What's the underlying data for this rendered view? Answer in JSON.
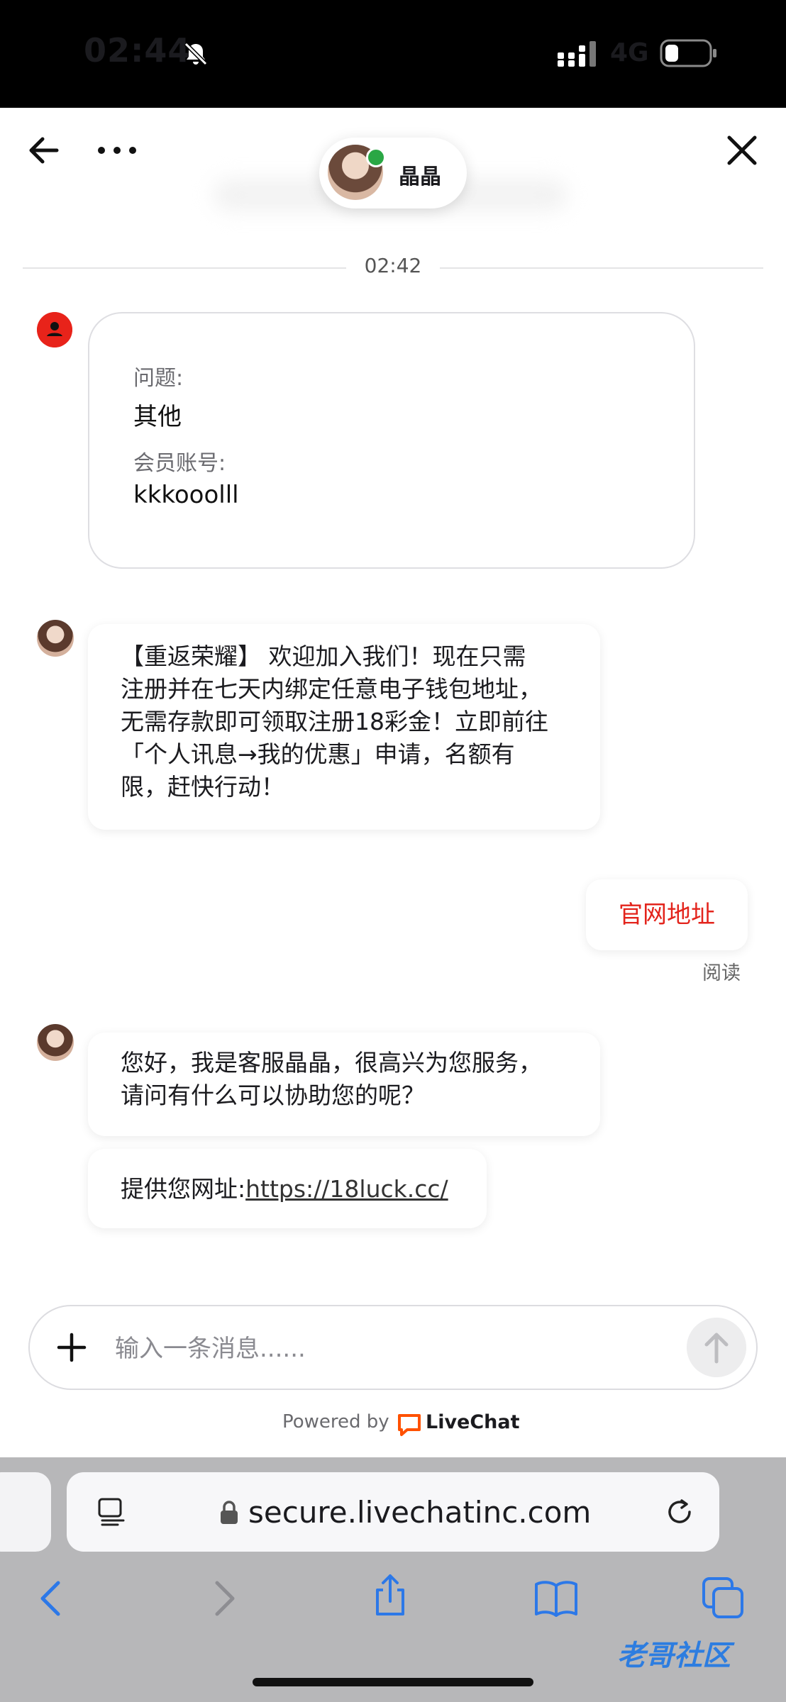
{
  "status_bar": {
    "time": "02:44",
    "network": "4G"
  },
  "header": {
    "agent_name": "晶晶"
  },
  "divider": {
    "time": "02:42"
  },
  "form": {
    "question_label": "问题:",
    "question_value": "其他",
    "account_label": "会员账号:",
    "account_value": "kkkooolll"
  },
  "messages": {
    "promo": "【重返荣耀】 欢迎加入我们！现在只需\n注册并在七天内绑定任意电子钱包地址，\n无需存款即可领取注册18彩金！立即前往\n「个人讯息→我的优惠」申请，名额有\n限，赶快行动！",
    "visitor": "官网地址",
    "read_status": "阅读",
    "greeting": "您好，我是客服晶晶，很高兴为您服务，\n请问有什么可以协助您的呢？",
    "link_prefix": "提供您网址:",
    "link_url": "https://18luck.cc/"
  },
  "composer": {
    "placeholder": "输入一条消息......"
  },
  "footer": {
    "powered_by": "Powered by",
    "brand": "LiveChat",
    "brand_color": "#ff5100"
  },
  "browser": {
    "url": "secure.livechatinc.com"
  },
  "watermark": "老哥社区",
  "colors": {
    "visitor_text": "#e3241c",
    "online": "#2aa745",
    "visitor_avatar": "#e8231a"
  }
}
